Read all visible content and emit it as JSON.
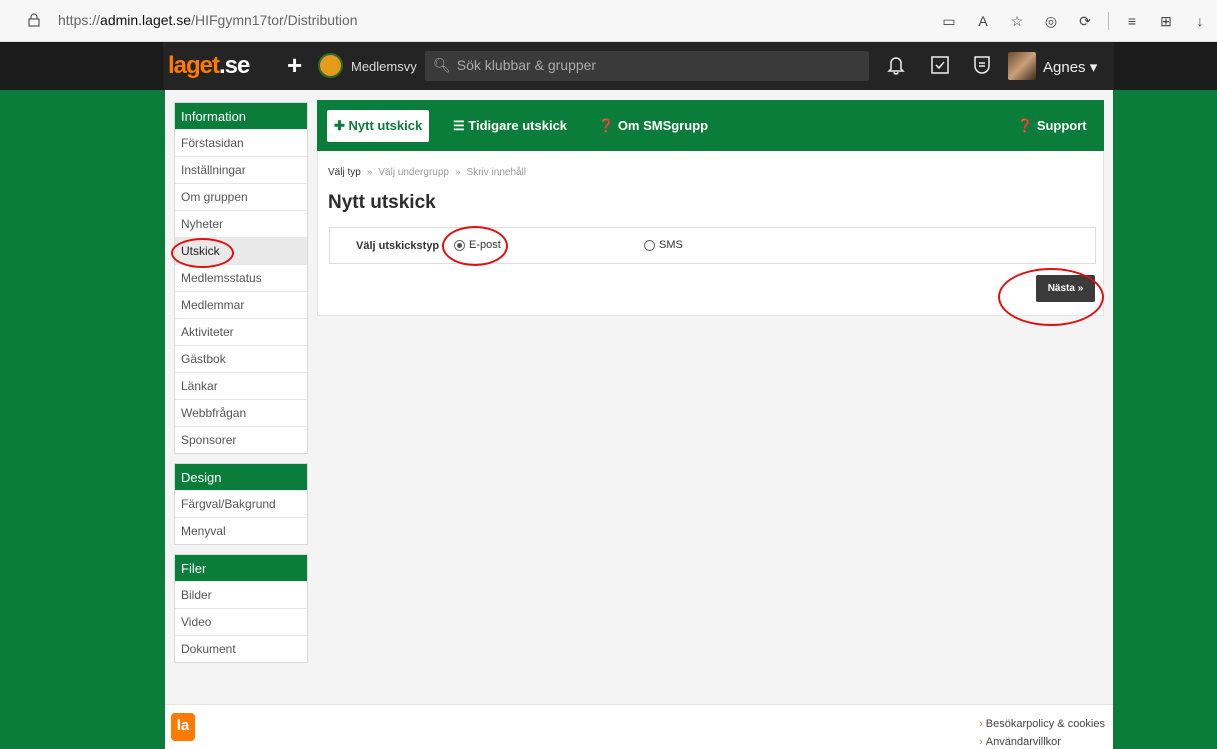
{
  "browser": {
    "url_prefix": "https://",
    "url_host": "admin.laget.se",
    "url_path": "/HIFgymn17tor/Distribution"
  },
  "topnav": {
    "logo_main": "laget",
    "logo_tld": ".se",
    "plus": "+",
    "member_view": "Medlemsvy",
    "search_placeholder": "Sök klubbar & grupper",
    "user_name": "Agnes"
  },
  "sidebar": {
    "groups": [
      {
        "title": "Information",
        "items": [
          "Förstasidan",
          "Inställningar",
          "Om gruppen",
          "Nyheter",
          "Utskick",
          "Medlemsstatus",
          "Medlemmar",
          "Aktiviteter",
          "Gästbok",
          "Länkar",
          "Webbfrågan",
          "Sponsorer"
        ]
      },
      {
        "title": "Design",
        "items": [
          "Färgval/Bakgrund",
          "Menyval"
        ]
      },
      {
        "title": "Filer",
        "items": [
          "Bilder",
          "Video",
          "Dokument"
        ]
      }
    ],
    "active": "Utskick"
  },
  "panel": {
    "new_btn": "Nytt utskick",
    "prev_btn": "Tidigare utskick",
    "about_btn": "Om SMSgrupp",
    "support_btn": "Support",
    "crumbs": [
      "Välj typ",
      "Välj undergrupp",
      "Skriv innehåll"
    ],
    "crumb_sep": "»",
    "title": "Nytt utskick",
    "type_label": "Välj utskickstyp",
    "options": [
      "E-post",
      "SMS"
    ],
    "selected": "E-post",
    "next_btn": "Nästa »"
  },
  "footer": {
    "links": [
      "Besökarpolicy & cookies",
      "Användarvillkor"
    ]
  },
  "colors": {
    "brand_green": "#0b7d3a",
    "brand_orange": "#ff7a00",
    "annotation_red": "#e01010"
  }
}
